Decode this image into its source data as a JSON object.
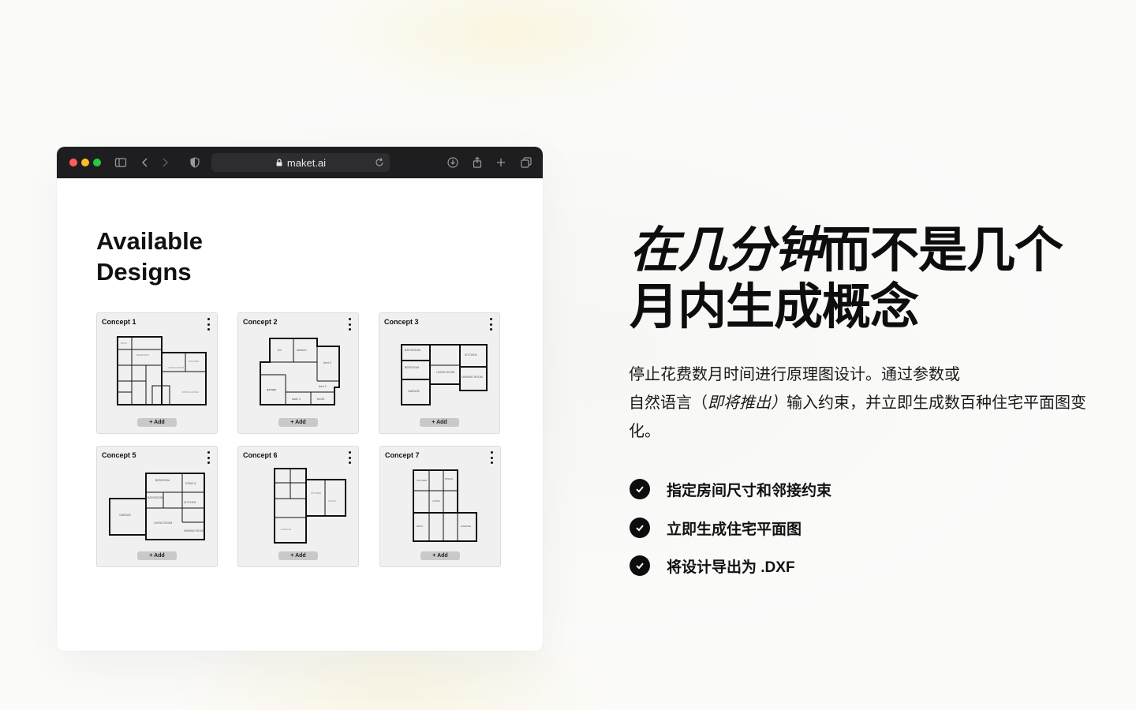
{
  "browser": {
    "url": "maket.ai",
    "colors": {
      "toolbar": "#1e1e20",
      "close": "#ff5f57",
      "minimize": "#febc2e",
      "zoom": "#28c840"
    }
  },
  "page": {
    "title": "Available Designs",
    "cards": [
      {
        "title": "Concept 1",
        "add_label": "+ Add"
      },
      {
        "title": "Concept 2",
        "add_label": "+ Add"
      },
      {
        "title": "Concept 3",
        "add_label": "+ Add"
      },
      {
        "title": "Concept 5",
        "add_label": "+ Add"
      },
      {
        "title": "Concept 6",
        "add_label": "+ Add"
      },
      {
        "title": "Concept 7",
        "add_label": "+ Add"
      }
    ]
  },
  "hero": {
    "headline_italic": "在几分钟",
    "headline_rest": "而不是几个月内生成概念",
    "desc_part1": "停止花费数月时间进行原理图设计。通过参数或",
    "desc_part2": "自然语言（",
    "desc_italic": "即将推出）",
    "desc_part3": "输入约束，并立即生成数百种住宅平面图变化。",
    "features": [
      "指定房间尺寸和邻接约束",
      "立即生成住宅平面图",
      "将设计导出为 .DXF"
    ]
  }
}
